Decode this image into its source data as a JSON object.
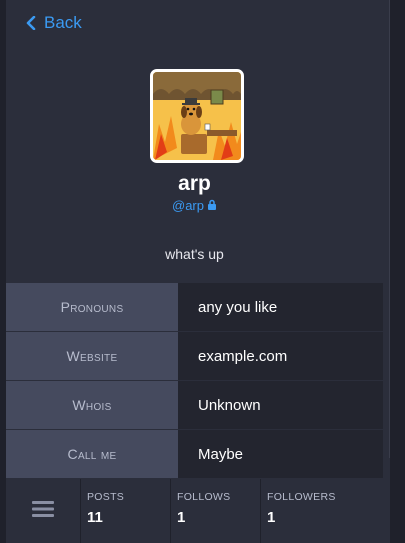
{
  "header": {
    "back_label": "Back"
  },
  "profile": {
    "display_name": "arp",
    "handle": "@arp",
    "locked": true,
    "bio": "what's up"
  },
  "fields": [
    {
      "name": "Pronouns",
      "value": "any you like"
    },
    {
      "name": "Website",
      "value": "example.com"
    },
    {
      "name": "Whois",
      "value": "Unknown"
    },
    {
      "name": "Call me",
      "value": "Maybe"
    }
  ],
  "stats": [
    {
      "label": "POSTS",
      "count": "11"
    },
    {
      "label": "FOLLOWS",
      "count": "1"
    },
    {
      "label": "FOLLOWERS",
      "count": "1"
    }
  ],
  "colors": {
    "accent": "#3b9af2",
    "background": "#2b2e3b",
    "field_key_bg": "#454a5e",
    "field_value_bg": "#23252f"
  },
  "icons": [
    "chevron-left-icon",
    "lock-icon",
    "hamburger-menu-icon"
  ]
}
